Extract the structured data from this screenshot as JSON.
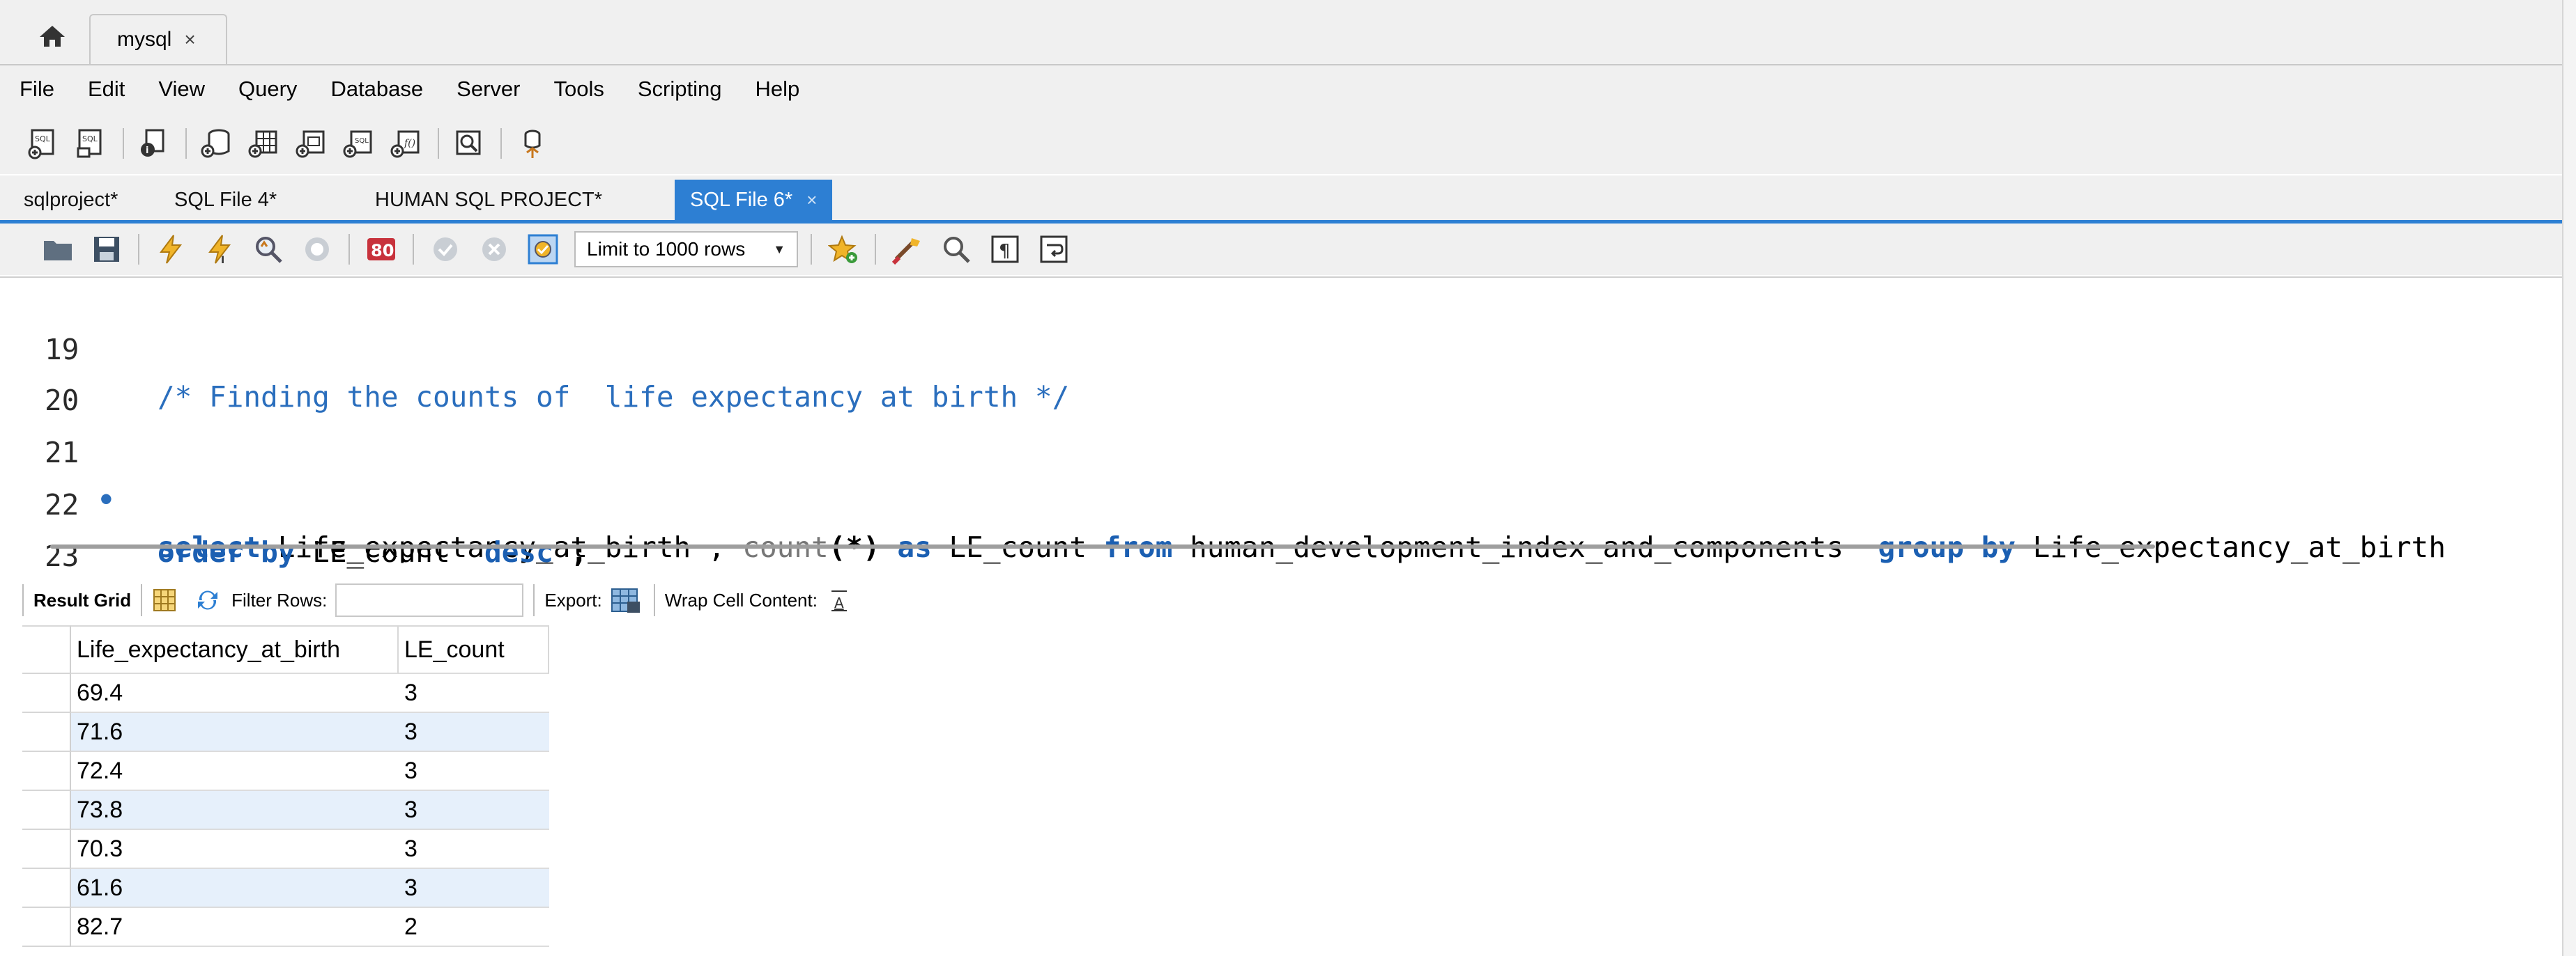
{
  "window_tabs": {
    "home_icon": "home-icon",
    "connection_tab": "mysql",
    "close_glyph": "×"
  },
  "menu": [
    "File",
    "Edit",
    "View",
    "Query",
    "Database",
    "Server",
    "Tools",
    "Scripting",
    "Help"
  ],
  "editor_tabs": [
    {
      "label": "sqlproject*"
    },
    {
      "label": "SQL File 4*"
    },
    {
      "label": "HUMAN SQL PROJECT*"
    },
    {
      "label": "SQL File 6*",
      "active": true
    }
  ],
  "sql_toolbar": {
    "limit_select": "Limit to 1000 rows"
  },
  "editor": {
    "lines": [
      {
        "num": "19",
        "comment": "/* Finding the counts of  life expectancy at birth */"
      },
      {
        "num": "20"
      },
      {
        "num": "21",
        "marker": "•",
        "t1": "select",
        "t2": " Life_expectancy_at_birth , ",
        "t3": "count",
        "t4": "(*)",
        "t5": " as",
        "t6": " LE_count ",
        "t7": "from",
        "t8": " human_development_index_and_components  ",
        "t9": "group by",
        "t10": " Life_expectancy_at_birth"
      },
      {
        "num": "22",
        "t1": "order by",
        "t2": " LE_count  ",
        "t3": "desc",
        "t4": " ;"
      },
      {
        "num": "23"
      }
    ]
  },
  "result_toolbar": {
    "result_grid": "Result Grid",
    "filter_rows": "Filter Rows:",
    "export": "Export:",
    "wrap": "Wrap Cell Content:"
  },
  "result_grid": {
    "columns": [
      "Life_expectancy_at_birth",
      "LE_count"
    ],
    "rows": [
      [
        "69.4",
        "3"
      ],
      [
        "71.6",
        "3"
      ],
      [
        "72.4",
        "3"
      ],
      [
        "73.8",
        "3"
      ],
      [
        "70.3",
        "3"
      ],
      [
        "61.6",
        "3"
      ],
      [
        "82.7",
        "2"
      ]
    ]
  },
  "colors": {
    "accent": "#2d7fd3",
    "keyword": "#1b5fb2",
    "comment": "#2a6ebd",
    "row_alt": "#e6f0fb"
  }
}
